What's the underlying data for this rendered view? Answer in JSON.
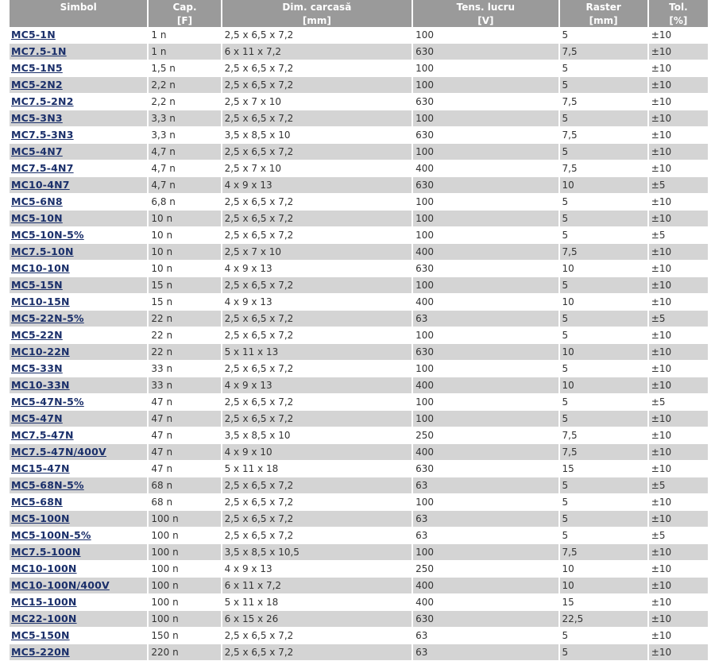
{
  "header": {
    "symbol": "Simbol",
    "cap": "Cap.",
    "dim": "Dim. carcasă",
    "tens": "Tens. lucru",
    "raster": "Raster",
    "tol": "Tol.",
    "cap_unit": "[F]",
    "dim_unit": "[mm]",
    "tens_unit": "[V]",
    "raster_unit": "[mm]",
    "tol_unit": "[%]"
  },
  "rows": [
    {
      "symbol": "MC5-1N",
      "cap": "1 n",
      "dim": "2,5 x 6,5 x 7,2",
      "tens": "100",
      "raster": "5",
      "tol": "±10"
    },
    {
      "symbol": "MC7.5-1N",
      "cap": "1 n",
      "dim": "6 x 11 x 7,2",
      "tens": "630",
      "raster": "7,5",
      "tol": "±10"
    },
    {
      "symbol": "MC5-1N5",
      "cap": "1,5 n",
      "dim": "2,5 x 6,5 x 7,2",
      "tens": "100",
      "raster": "5",
      "tol": "±10"
    },
    {
      "symbol": "MC5-2N2",
      "cap": "2,2 n",
      "dim": "2,5 x 6,5 x 7,2",
      "tens": "100",
      "raster": "5",
      "tol": "±10"
    },
    {
      "symbol": "MC7.5-2N2",
      "cap": "2,2 n",
      "dim": "2,5 x 7 x 10",
      "tens": "630",
      "raster": "7,5",
      "tol": "±10"
    },
    {
      "symbol": "MC5-3N3",
      "cap": "3,3 n",
      "dim": "2,5 x 6,5 x 7,2",
      "tens": "100",
      "raster": "5",
      "tol": "±10"
    },
    {
      "symbol": "MC7.5-3N3",
      "cap": "3,3 n",
      "dim": "3,5 x 8,5 x 10",
      "tens": "630",
      "raster": "7,5",
      "tol": "±10"
    },
    {
      "symbol": "MC5-4N7",
      "cap": "4,7 n",
      "dim": "2,5 x 6,5 x 7,2",
      "tens": "100",
      "raster": "5",
      "tol": "±10"
    },
    {
      "symbol": "MC7.5-4N7",
      "cap": "4,7 n",
      "dim": "2,5 x 7 x 10",
      "tens": "400",
      "raster": "7,5",
      "tol": "±10"
    },
    {
      "symbol": "MC10-4N7",
      "cap": "4,7 n",
      "dim": "4 x 9 x 13",
      "tens": "630",
      "raster": "10",
      "tol": "±5"
    },
    {
      "symbol": "MC5-6N8",
      "cap": "6,8 n",
      "dim": "2,5 x 6,5 x 7,2",
      "tens": "100",
      "raster": "5",
      "tol": "±10"
    },
    {
      "symbol": "MC5-10N",
      "cap": "10 n",
      "dim": "2,5 x 6,5 x 7,2",
      "tens": "100",
      "raster": "5",
      "tol": "±10"
    },
    {
      "symbol": "MC5-10N-5%",
      "cap": "10 n",
      "dim": "2,5 x 6,5 x 7,2",
      "tens": "100",
      "raster": "5",
      "tol": "±5"
    },
    {
      "symbol": "MC7.5-10N",
      "cap": "10 n",
      "dim": "2,5 x 7 x 10",
      "tens": "400",
      "raster": "7,5",
      "tol": "±10"
    },
    {
      "symbol": "MC10-10N",
      "cap": "10 n",
      "dim": "4 x 9 x 13",
      "tens": "630",
      "raster": "10",
      "tol": "±10"
    },
    {
      "symbol": "MC5-15N",
      "cap": "15 n",
      "dim": "2,5 x 6,5 x 7,2",
      "tens": "100",
      "raster": "5",
      "tol": "±10"
    },
    {
      "symbol": "MC10-15N",
      "cap": "15 n",
      "dim": "4 x 9 x 13",
      "tens": "400",
      "raster": "10",
      "tol": "±10"
    },
    {
      "symbol": "MC5-22N-5%",
      "cap": "22 n",
      "dim": "2,5 x 6,5 x 7,2",
      "tens": "63",
      "raster": "5",
      "tol": "±5"
    },
    {
      "symbol": "MC5-22N",
      "cap": "22 n",
      "dim": "2,5 x 6,5 x 7,2",
      "tens": "100",
      "raster": "5",
      "tol": "±10"
    },
    {
      "symbol": "MC10-22N",
      "cap": "22 n",
      "dim": "5 x 11 x 13",
      "tens": "630",
      "raster": "10",
      "tol": "±10"
    },
    {
      "symbol": "MC5-33N",
      "cap": "33 n",
      "dim": "2,5 x 6,5 x 7,2",
      "tens": "100",
      "raster": "5",
      "tol": "±10"
    },
    {
      "symbol": "MC10-33N",
      "cap": "33 n",
      "dim": "4 x 9 x 13",
      "tens": "400",
      "raster": "10",
      "tol": "±10"
    },
    {
      "symbol": "MC5-47N-5%",
      "cap": "47 n",
      "dim": "2,5 x 6,5 x 7,2",
      "tens": "100",
      "raster": "5",
      "tol": "±5"
    },
    {
      "symbol": "MC5-47N",
      "cap": "47 n",
      "dim": "2,5 x 6,5 x 7,2",
      "tens": "100",
      "raster": "5",
      "tol": "±10"
    },
    {
      "symbol": "MC7.5-47N",
      "cap": "47 n",
      "dim": "3,5 x 8,5 x 10",
      "tens": "250",
      "raster": "7,5",
      "tol": "±10"
    },
    {
      "symbol": "MC7.5-47N/400V",
      "cap": "47 n",
      "dim": "4 x 9 x 10",
      "tens": "400",
      "raster": "7,5",
      "tol": "±10"
    },
    {
      "symbol": "MC15-47N",
      "cap": "47 n",
      "dim": "5 x 11 x 18",
      "tens": "630",
      "raster": "15",
      "tol": "±10"
    },
    {
      "symbol": "MC5-68N-5%",
      "cap": "68 n",
      "dim": "2,5 x 6,5 x 7,2",
      "tens": "63",
      "raster": "5",
      "tol": "±5"
    },
    {
      "symbol": "MC5-68N",
      "cap": "68 n",
      "dim": "2,5 x 6,5 x 7,2",
      "tens": "100",
      "raster": "5",
      "tol": "±10"
    },
    {
      "symbol": "MC5-100N",
      "cap": "100 n",
      "dim": "2,5 x 6,5 x 7,2",
      "tens": "63",
      "raster": "5",
      "tol": "±10"
    },
    {
      "symbol": "MC5-100N-5%",
      "cap": "100 n",
      "dim": "2,5 x 6,5 x 7,2",
      "tens": "63",
      "raster": "5",
      "tol": "±5"
    },
    {
      "symbol": "MC7.5-100N",
      "cap": "100 n",
      "dim": "3,5 x 8,5 x 10,5",
      "tens": "100",
      "raster": "7,5",
      "tol": "±10"
    },
    {
      "symbol": "MC10-100N",
      "cap": "100 n",
      "dim": "4 x 9 x 13",
      "tens": "250",
      "raster": "10",
      "tol": "±10"
    },
    {
      "symbol": "MC10-100N/400V",
      "cap": "100 n",
      "dim": "6 x 11 x 7,2",
      "tens": "400",
      "raster": "10",
      "tol": "±10"
    },
    {
      "symbol": "MC15-100N",
      "cap": "100 n",
      "dim": "5 x 11 x 18",
      "tens": "400",
      "raster": "15",
      "tol": "±10"
    },
    {
      "symbol": "MC22-100N",
      "cap": "100 n",
      "dim": "6 x 15 x 26",
      "tens": "630",
      "raster": "22,5",
      "tol": "±10"
    },
    {
      "symbol": "MC5-150N",
      "cap": "150 n",
      "dim": "2,5 x 6,5 x 7,2",
      "tens": "63",
      "raster": "5",
      "tol": "±10"
    },
    {
      "symbol": "MC5-220N",
      "cap": "220 n",
      "dim": "2,5 x 6,5 x 7,2",
      "tens": "63",
      "raster": "5",
      "tol": "±10"
    }
  ]
}
